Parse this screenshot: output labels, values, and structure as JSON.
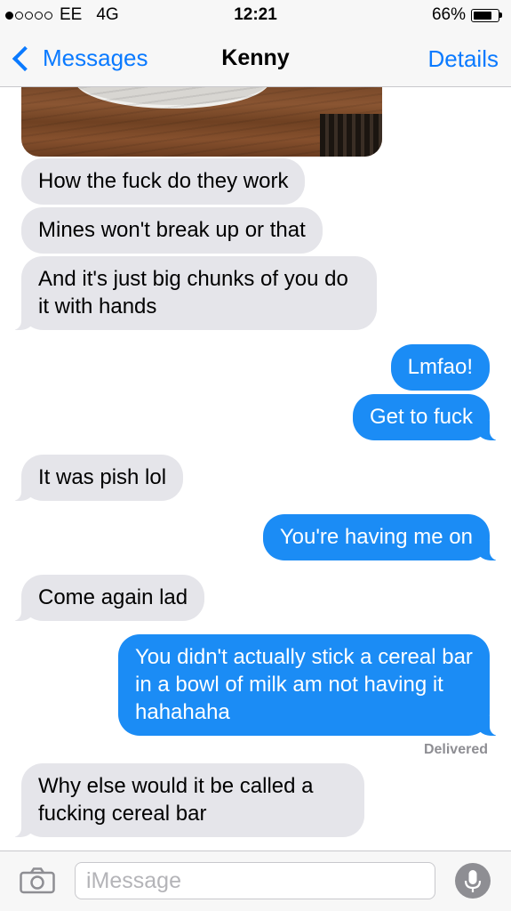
{
  "status_bar": {
    "signal_dots_filled": 1,
    "signal_dots_total": 5,
    "carrier": "EE",
    "network": "4G",
    "time": "12:21",
    "battery_percent": "66%",
    "battery_level": 0.66
  },
  "nav": {
    "back_label": "Messages",
    "title": "Kenny",
    "details_label": "Details",
    "accent_color": "#0a7aff"
  },
  "messages": [
    {
      "from": "them",
      "text": "How the fuck do they work"
    },
    {
      "from": "them",
      "text": "Mines won't break up or that"
    },
    {
      "from": "them",
      "text": "And it's just big chunks of you do it with hands"
    },
    {
      "from": "me",
      "text": "Lmfao!"
    },
    {
      "from": "me",
      "text": "Get to fuck"
    },
    {
      "from": "them",
      "text": "It was pish lol"
    },
    {
      "from": "me",
      "text": "You're having me on"
    },
    {
      "from": "them",
      "text": "Come again lad"
    },
    {
      "from": "me",
      "text": "You didn't actually stick a cereal bar in a bowl of milk am not having it hahahaha"
    },
    {
      "from": "them",
      "text": "Why else would it be called a fucking cereal bar"
    }
  ],
  "delivered_label": "Delivered",
  "composer": {
    "placeholder": "iMessage",
    "camera_icon": "camera-icon",
    "mic_icon": "microphone-icon"
  },
  "colors": {
    "incoming_bubble": "#e5e5ea",
    "outgoing_bubble": "#1b8cf5"
  }
}
